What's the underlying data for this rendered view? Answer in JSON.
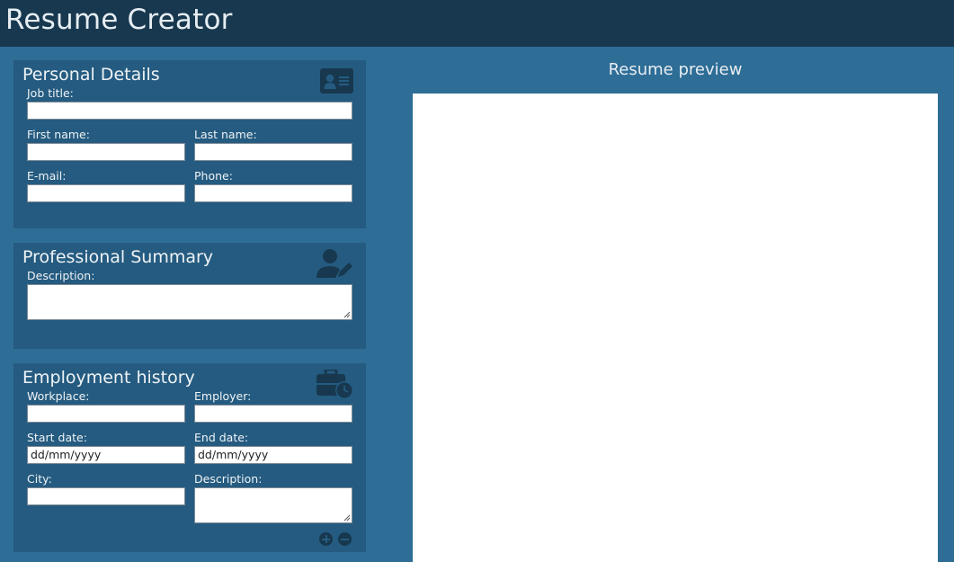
{
  "app": {
    "title": "Resume Creator"
  },
  "personal": {
    "title": "Personal Details",
    "icon": "id-card-icon",
    "job_title_label": "Job title:",
    "first_name_label": "First name:",
    "last_name_label": "Last name:",
    "email_label": "E-mail:",
    "phone_label": "Phone:"
  },
  "summary": {
    "title": "Professional Summary",
    "icon": "user-edit-icon",
    "description_label": "Description:"
  },
  "employment": {
    "title": "Employment history",
    "icon": "briefcase-clock-icon",
    "workplace_label": "Workplace:",
    "employer_label": "Employer:",
    "start_date_label": "Start date:",
    "start_date_value": "dd/mm/yyyy",
    "end_date_label": "End date:",
    "end_date_value": "dd/mm/yyyy",
    "city_label": "City:",
    "description_label": "Description:"
  },
  "preview": {
    "title": "Resume preview"
  },
  "colors": {
    "page_bg": "#2e6d96",
    "header_bg": "#17384f",
    "card_bg": "#255b80",
    "icon": "#17384f",
    "preview_bg": "#ffffff"
  }
}
